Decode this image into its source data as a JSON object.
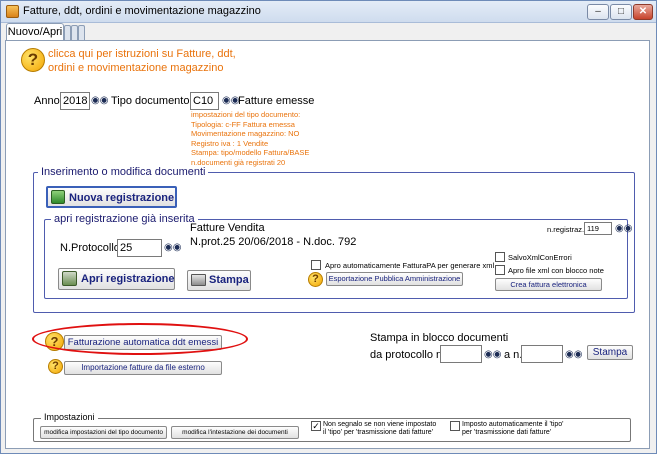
{
  "window": {
    "title": "Fatture, ddt, ordini e movimentazione magazzino"
  },
  "tabs": [
    {
      "label": "Nuovo/Apri"
    }
  ],
  "help": {
    "line1": "clicca qui per istruzioni su Fatture, ddt,",
    "line2": "ordini e movimentazione magazzino"
  },
  "anno": {
    "label": "Anno",
    "value": "2018"
  },
  "tipo_documento": {
    "label": "Tipo documento",
    "value": "C10",
    "description": "Fatture emesse",
    "info": [
      "impostazioni del tipo documento:",
      "Tipologia: c-FF Fattura emessa",
      "Movimentazione magazzino: NO",
      "Registro iva : 1 Vendite",
      "Stampa: tipo/modello Fattura/BASE",
      "n.documenti già registrati 20"
    ]
  },
  "inserimento": {
    "title": "Inserimento o modifica documenti",
    "nuova_label": "Nuova registrazione"
  },
  "apri": {
    "title": "apri registrazione già inserita",
    "doc_title": "Fatture Vendita",
    "doc_info": "N.prot.25 20/06/2018 - N.doc. 792",
    "nregistraz_label": "n.registraz.",
    "nregistraz_value": "119",
    "nprotocollo_label": "N.Protocollo",
    "nprotocollo_value": "25",
    "apri_label": "Apri registrazione",
    "stampa_label": "Stampa",
    "fatturapa_check_label": "Apro automaticamente FatturaPA per generare xml",
    "esportazione_label": "Esportazione Pubblica Amministrazione",
    "salvo_label": "SalvoXmlConErrori",
    "apro_file_label": "Apro file xml con blocco note",
    "crea_label": "Crea fattura elettronica"
  },
  "fatturazione": {
    "auto_label": "Fatturazione automatica ddt emessi",
    "import_label": "Importazione fatture da file esterno"
  },
  "stampa_blocco": {
    "title": "Stampa in blocco documenti",
    "da_label": "da protocollo n.",
    "a_label": "a n.",
    "stampa_label": "Stampa",
    "da_value": "",
    "a_value": ""
  },
  "impostazioni": {
    "title": "Impostazioni",
    "mod_tipo_label": "modifica impostazioni del tipo documento",
    "mod_intest_label": "modifica l'intestazione dei documenti",
    "non_segnalo_line1": "Non segnalo se non viene impostato",
    "non_segnalo_line2": "il 'tipo' per 'trasmissione dati fatture'",
    "imposto_line1": "Imposto automaticamente il 'tipo'",
    "imposto_line2": "per 'trasmissione dati fatture'"
  },
  "colors": {
    "accent_orange": "#e9730c",
    "group_border": "#4f5cae",
    "highlight_red": "#e01010"
  }
}
